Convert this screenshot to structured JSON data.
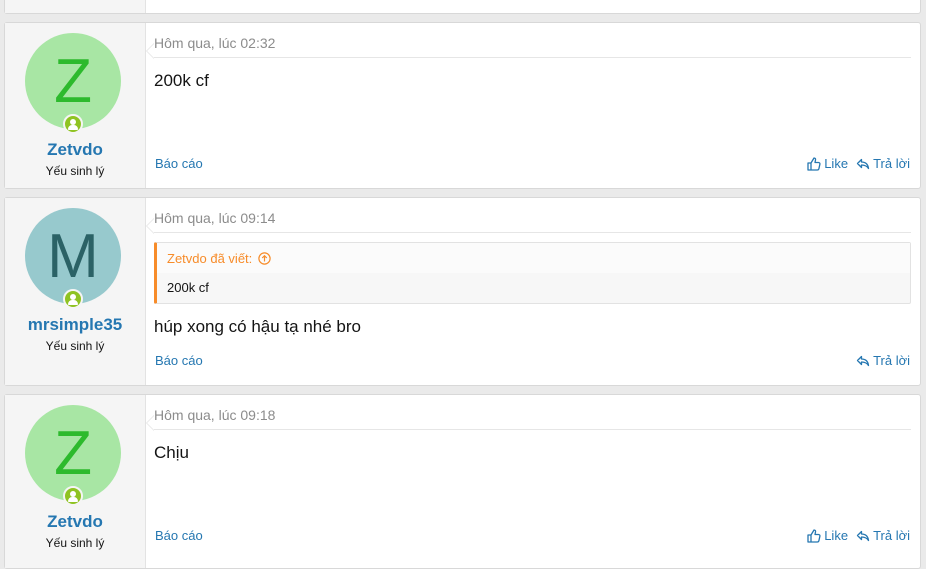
{
  "posts": [
    {
      "avatar_letter": "Z",
      "username": "Zetvdo",
      "user_title": "Yếu sinh lý",
      "date": "Hôm qua, lúc 02:32",
      "message": "200k cf",
      "report_label": "Báo cáo",
      "like_label": "Like",
      "reply_label": "Trả lời"
    },
    {
      "avatar_letter": "M",
      "username": "mrsimple35",
      "user_title": "Yếu sinh lý",
      "date": "Hôm qua, lúc 09:14",
      "quote_author": "Zetvdo đã viết:",
      "quote_text": "200k cf",
      "message": "húp xong có hậu tạ nhé bro",
      "report_label": "Báo cáo",
      "reply_label": "Trả lời"
    },
    {
      "avatar_letter": "Z",
      "username": "Zetvdo",
      "user_title": "Yếu sinh lý",
      "date": "Hôm qua, lúc 09:18",
      "message": "Chịu",
      "report_label": "Báo cáo",
      "like_label": "Like",
      "reply_label": "Trả lời"
    }
  ],
  "colors": {
    "link": "#2577b1",
    "online": "#8fc322",
    "quote_accent": "#f78c2a",
    "avatar_z_bg": "#a8e6a4",
    "avatar_z_fg": "#2dba2d",
    "avatar_m_bg": "#97c9cd",
    "avatar_m_fg": "#2b6266"
  },
  "icons": {
    "online": "user-online-icon",
    "like": "thumbs-up-icon",
    "reply": "reply-icon",
    "quote_jump": "arrow-up-circle-icon"
  }
}
